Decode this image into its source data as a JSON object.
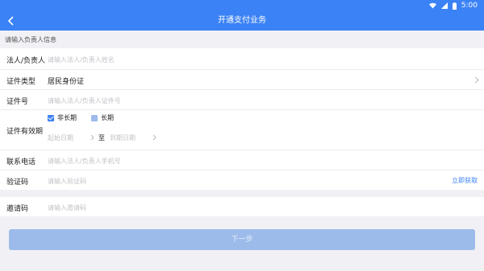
{
  "status_bar": {
    "time": "5:00",
    "icons": [
      "wifi-icon",
      "signal-icon",
      "battery-icon"
    ]
  },
  "header": {
    "title": "开通支付业务",
    "back_icon": "chevron-left-icon"
  },
  "section_hint": "请输入负责人信息",
  "form": {
    "legal_person": {
      "label": "法人/负责人",
      "placeholder": "请输入法人/负责人姓名"
    },
    "id_type": {
      "label": "证件类型",
      "value": "居民身份证"
    },
    "id_number": {
      "label": "证件号",
      "placeholder": "请输入法人/负责人证件号"
    },
    "validity": {
      "label": "证件有效期",
      "option_short": "非长期",
      "option_long": "长期",
      "selected": "非长期",
      "start_placeholder": "起始日期",
      "separator": "至",
      "end_placeholder": "到期日期"
    },
    "phone": {
      "label": "联系电话",
      "placeholder": "请输入法人/负责人手机号"
    },
    "code": {
      "label": "验证码",
      "placeholder": "请输入验证码",
      "action": "立即获取"
    },
    "invite": {
      "label": "邀请码",
      "placeholder": "请输入邀请码"
    }
  },
  "next_button": {
    "label": "下一步"
  },
  "colors": {
    "primary": "#3b82f6",
    "button_disabled": "#9dbbea",
    "background": "#f1f1f5",
    "placeholder": "#c2c2c8"
  }
}
